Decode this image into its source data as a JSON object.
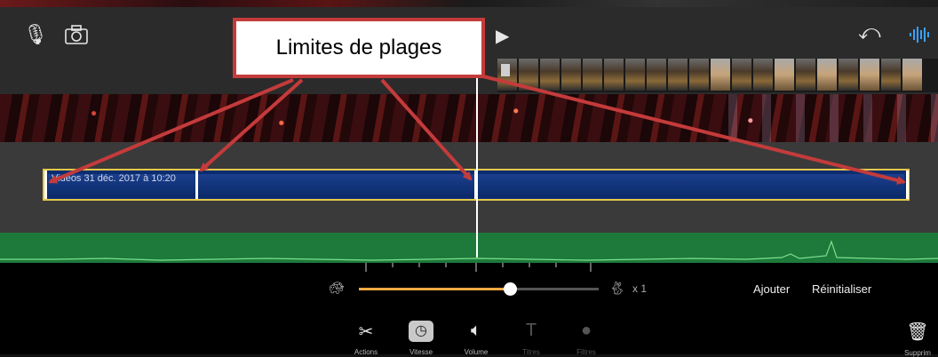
{
  "callout": {
    "text": "Limites de plages"
  },
  "toolbar": {
    "icons": [
      "microphone-icon",
      "camera-icon",
      "play-icon",
      "undo-icon",
      "audio-waveform-icon"
    ]
  },
  "timeline": {
    "clip_label": "Vidéos 31 déc. 2017 à 10:20",
    "colors": {
      "range_outline": "#e6c84a",
      "clip_fill": "#0b2d70",
      "audio_track": "#1d7a3a",
      "callout_border": "#c43b3b"
    }
  },
  "speed": {
    "value_label": "x 1",
    "slider_fraction": 0.63,
    "add_label": "Ajouter",
    "reset_label": "Réinitialiser"
  },
  "tabs": [
    {
      "label": "Actions",
      "icon": "scissors-icon"
    },
    {
      "label": "Vitesse",
      "icon": "speedometer-icon"
    },
    {
      "label": "Volume",
      "icon": "speaker-icon"
    },
    {
      "label": "Titres",
      "icon": "titles-icon"
    },
    {
      "label": "Filtres",
      "icon": "filters-icon"
    }
  ],
  "delete": {
    "label": "Supprim",
    "icon": "trash-icon"
  }
}
